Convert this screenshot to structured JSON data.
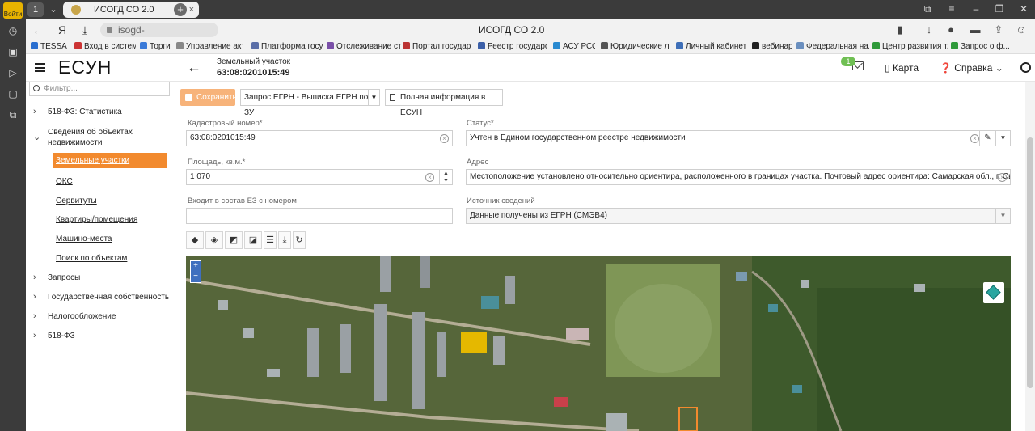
{
  "browser": {
    "login_label": "Войти",
    "tab_count": "1",
    "tab_title": "ИСОГД СО 2.0",
    "url": "isogd-app.samregion.ru",
    "page_title": "ИСОГД СО 2.0",
    "bookmarks": [
      "TESSA",
      "Вход в систему",
      "Торги",
      "Управление акти...",
      "Платформа госуд...",
      "Отслеживание ст...",
      "Портал государс...",
      "Реестр государст...",
      "АСУ РСО",
      "Юридические ли...",
      "Личный кабинет ...",
      "вебинар",
      "Федеральная нал...",
      "Центр развития т...",
      "Запрос о ф..."
    ]
  },
  "header": {
    "brand": "ЕСУН",
    "section": "Земельный участок",
    "cadastral": "63:08:0201015:49",
    "mail_badge": "1",
    "map_label": "Карта",
    "help_label": "Справка"
  },
  "sidebar": {
    "filter_placeholder": "Фильтр...",
    "items": [
      {
        "label": "518-ФЗ: Статистика"
      },
      {
        "label": "Сведения об объектах недвижимости"
      },
      {
        "label": "Запросы"
      },
      {
        "label": "Государственная собственность"
      },
      {
        "label": "Налогообложение"
      },
      {
        "label": "518-ФЗ"
      }
    ],
    "subitems": [
      {
        "label": "Земельные участки"
      },
      {
        "label": "ОКС"
      },
      {
        "label": "Сервитуты"
      },
      {
        "label": "Квартиры/помещения"
      },
      {
        "label": "Машино-места"
      },
      {
        "label": "Поиск по объектам"
      }
    ]
  },
  "toolbar": {
    "save_label": "Сохранить",
    "egrn_request_label": "Запрос ЕГРН - Выписка ЕГРН по ЗУ",
    "full_info_label": "Полная информация в ЕСУН"
  },
  "form": {
    "cadastral_label": "Кадастровый номер*",
    "cadastral_value": "63:08:0201015:49",
    "status_label": "Статус*",
    "status_value": "Учтен в Едином государственном реестре недвижимости",
    "area_label": "Площадь, кв.м.*",
    "area_value": "1 070",
    "address_label": "Адрес",
    "address_value": "Местоположение установлено относительно ориентира, расположенного в границах участка. Почтовый адрес ориентира: Самарская обл., г. Сызра...",
    "ez_label": "Входит в состав ЕЗ с номером",
    "ez_value": "",
    "source_label": "Источник сведений",
    "source_value": "Данные получены из ЕГРН (СМЭВ4)"
  },
  "map": {
    "zoom_in": "+",
    "zoom_out": "−"
  }
}
